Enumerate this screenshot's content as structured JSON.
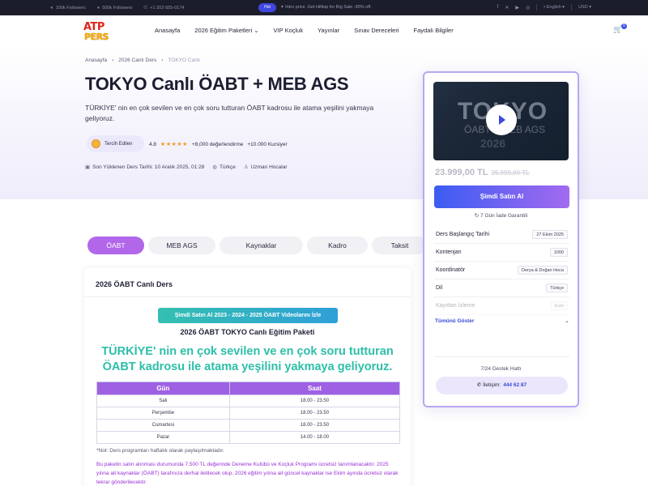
{
  "topbar": {
    "followers_1": "100k Followers",
    "followers_2": "500k Followers",
    "phone": "+1 202-555-0174",
    "promo_badge": "Hot",
    "promo_text": "Intro price. Get Hilltop for Big Sale -95% off.",
    "language": "English",
    "currency": "USD"
  },
  "header": {
    "logo_line1": "ATP",
    "logo_line2": "PERS",
    "nav": [
      "Anasayfa",
      "2026 Eğitim Paketleri",
      "VIP Koçluk",
      "Yayınlar",
      "Sınav Dereceleri",
      "Faydalı Bilgiler"
    ],
    "cart_count": "0"
  },
  "hero": {
    "breadcrumb": [
      "Anasayfa",
      "2026 Canlı Ders",
      "TOKYO Canlı"
    ],
    "title": "TOKYO Canlı ÖABT + MEB AGS",
    "subtitle": "TÜRKİYE' nin en çok sevilen ve en çok soru tutturan ÖABT kadrosu ile atama yeşilini yakmaya geliyoruz.",
    "badge": "Tercih Edilen",
    "rating": "4.8",
    "reviews": "+8,000 değerlendirme",
    "students": "+10.000 Kursiyer",
    "updated": "Son Yüklenen Ders Tarihi: 10 Aralık 2025, 01:28",
    "language": "Türkçe",
    "instructors": "Uzman Hocalar"
  },
  "tabs": [
    "ÖABT",
    "MEB AGS",
    "Kaynaklar",
    "Kadro",
    "Taksit"
  ],
  "content": {
    "card_title": "2026 ÖABT Canlı Ders",
    "banner": "Şimdi Satın Al 2023 - 2024 - 2025 ÖABT Videolarını İzle",
    "package_title": "2026 ÖABT TOKYO Canlı Eğitim Paketi",
    "tagline": "TÜRKİYE' nin en çok sevilen ve en çok soru tutturan ÖABT kadrosu ile atama yeşilini yakmaya geliyoruz.",
    "table_headers": [
      "Gün",
      "Saat"
    ],
    "table_rows": [
      [
        "Salı",
        "18.00 - 23.50"
      ],
      [
        "Perşembe",
        "18.00 - 23.50"
      ],
      [
        "Cumartesi",
        "18.00 - 23.50"
      ],
      [
        "Pazar",
        "14.00 - 18.00"
      ]
    ],
    "note": "*Not: Ders programları haftalık olarak paylaşılmaktadır.",
    "info_text": "Bu paketin satın alınması durumunda 7.500 TL değerinde Deneme Kulübü ve Koçluk Programı ücretsiz tanımlanacaktır. 2025 yılına ait kaynaklar (ÖABT) tarafınıza derhal iletilecek olup, 2026 eğitim yılına ait güncel kaynaklar ise Ekim ayında ücretsiz olarak tekrar gönderilecektir."
  },
  "sidebar": {
    "video_watermark": [
      "TOKYO",
      "ÖABT + MEB AGS",
      "2026"
    ],
    "price": "23.999,00 TL",
    "old_price": "25.999,00 TL",
    "buy_label": "Şimdi Satın Al",
    "guarantee": "7 Gün İade Garantili",
    "info": [
      {
        "key": "Ders Başlangıç Tarihi",
        "value": "27 Ekim 2025"
      },
      {
        "key": "Kontenjan",
        "value": "1000"
      },
      {
        "key": "Koordinatör",
        "value": "Derya & Doğan Hoca"
      },
      {
        "key": "Dil",
        "value": "Türkçe"
      },
      {
        "key": "Kayıttan İzleme",
        "value": "Evet"
      }
    ],
    "show_all": "Tümünü Göster",
    "support": "7/24 Destek Hattı",
    "call_label": "İletişim:",
    "call_number": "444 62 87"
  }
}
